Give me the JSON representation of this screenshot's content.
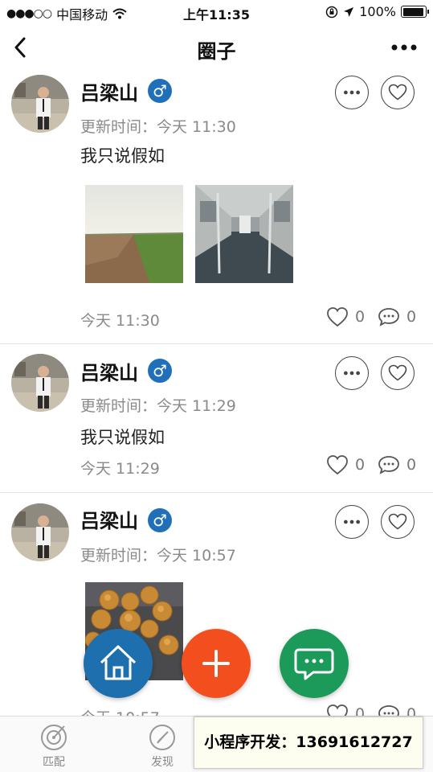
{
  "status_bar": {
    "carrier": "中国移动",
    "time": "上午11:35",
    "battery": "100%"
  },
  "navbar": {
    "title": "圈子"
  },
  "posts": [
    {
      "author": "吕梁山",
      "gender": "♂",
      "updated": "更新时间：今天 11:30",
      "text": "我只说假如",
      "time": "今天 11:30",
      "likes": "0",
      "comments": "0"
    },
    {
      "author": "吕梁山",
      "gender": "♂",
      "updated": "更新时间：今天 11:29",
      "text": "我只说假如",
      "time": "今天 11:29",
      "likes": "0",
      "comments": "0"
    },
    {
      "author": "吕梁山",
      "gender": "♂",
      "updated": "更新时间：今天 10:57",
      "text": "",
      "time": "今天 10:57",
      "likes": "0",
      "comments": "0"
    }
  ],
  "tabs": [
    {
      "label": "匹配",
      "icon": "radar-icon"
    },
    {
      "label": "发现",
      "icon": "compass-icon"
    }
  ],
  "banner": {
    "text": "小程序开发：13691612727"
  },
  "colors": {
    "gender_badge": "#1f70b8",
    "fab_home": "#1d6fae",
    "fab_add": "#f24e1e",
    "fab_chat": "#1b9a5a"
  }
}
